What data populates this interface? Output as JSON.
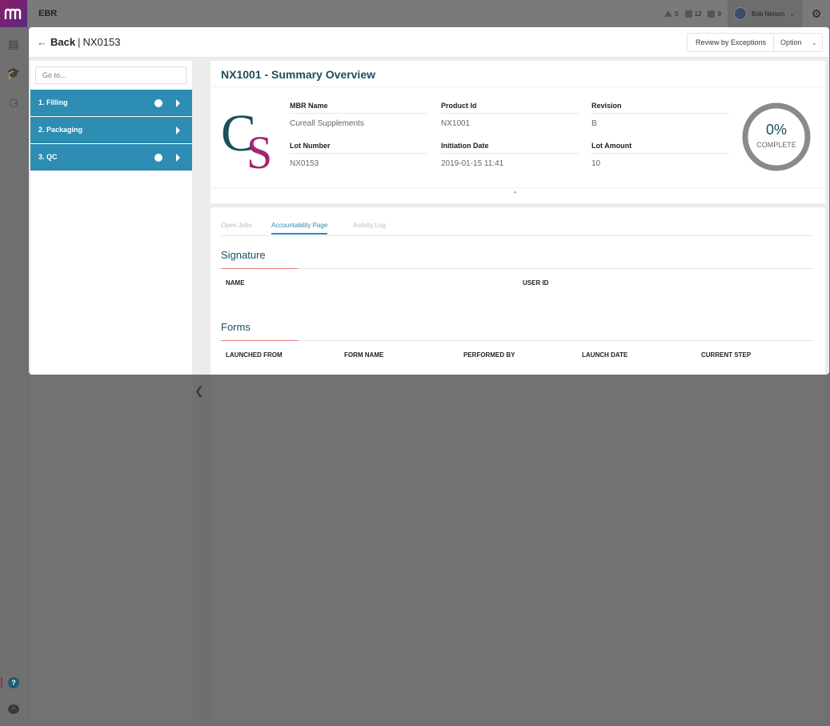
{
  "app": {
    "title": "EBR"
  },
  "top_stats": [
    {
      "value": "0"
    },
    {
      "value": "12"
    },
    {
      "value": "9"
    }
  ],
  "user": {
    "name": "Bob Nelson"
  },
  "modal": {
    "back_label": "Back",
    "batch_id": "NX0153",
    "review_button": "Review by Exceptions",
    "option_button": "Option"
  },
  "sidebar": {
    "search_placeholder": "Go to...",
    "steps": [
      {
        "label": "1.  Filling",
        "has_dot": true
      },
      {
        "label": "2.  Packaging",
        "has_dot": false
      },
      {
        "label": "3.  QC",
        "has_dot": true
      }
    ]
  },
  "summary": {
    "title": "NX1001 - Summary Overview",
    "fields": [
      {
        "label": "MBR Name",
        "value": "Cureall Supplements"
      },
      {
        "label": "Product Id",
        "value": "NX1001"
      },
      {
        "label": "Revision",
        "value": "B"
      },
      {
        "label": "Lot Number",
        "value": "NX0153"
      },
      {
        "label": "Initiation Date",
        "value": "2019-01-15 11:41"
      },
      {
        "label": "Lot Amount",
        "value": "10"
      }
    ],
    "progress": {
      "percent_text": "0%",
      "label": "COMPLETE",
      "value": 0
    }
  },
  "tabs": [
    {
      "label": "Open Jobs"
    },
    {
      "label": "Accountability Page"
    },
    {
      "label": "Activity Log"
    }
  ],
  "signature": {
    "title": "Signature",
    "columns": [
      "NAME",
      "USER ID"
    ]
  },
  "forms": {
    "title": "Forms",
    "columns": [
      "LAUNCHED FROM",
      "FORM NAME",
      "PERFORMED BY",
      "LAUNCH DATE",
      "CURRENT STEP"
    ]
  },
  "colors": {
    "accent": "#2d8db3",
    "brand": "#a3266e",
    "title": "#1d4e5e",
    "section_underline": "#e87a7a"
  }
}
